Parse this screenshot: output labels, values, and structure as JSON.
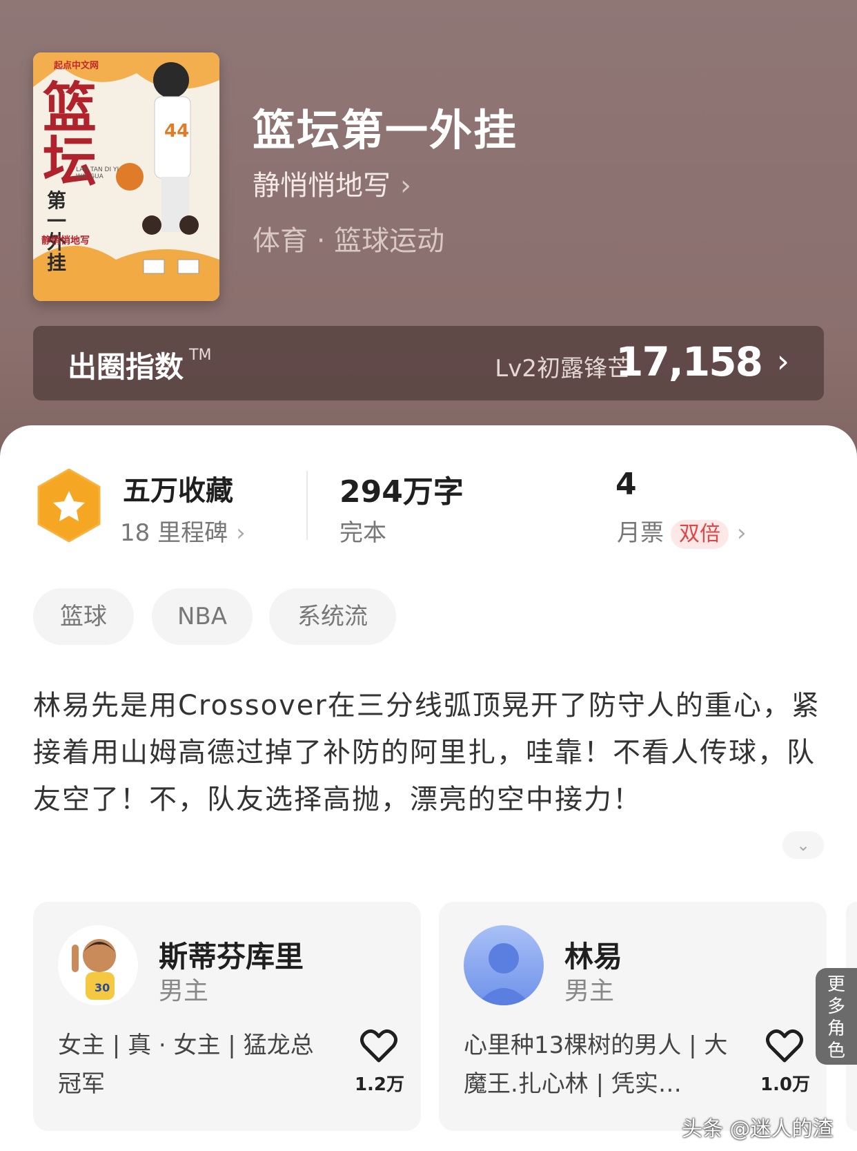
{
  "book": {
    "cover_publisher": "起点中文网",
    "cover_title_main": "篮坛",
    "cover_title_sub": "第一外挂",
    "cover_pinyin": "LAN TAN DI YI WAI GUA",
    "cover_author": "静悄悄地写",
    "title": "篮坛第一外挂",
    "author": "静悄悄地写",
    "genre": "体育 · 篮球运动"
  },
  "index": {
    "label": "出圈指数",
    "tm": "TM",
    "level": "Lv2初露锋芒",
    "value": "17,158"
  },
  "stats": {
    "collect_main": "五万收藏",
    "collect_sub": "18 里程碑",
    "words_main": "294万字",
    "words_sub": "完本",
    "ticket_main": "4",
    "ticket_sub": "月票",
    "ticket_badge": "双倍"
  },
  "tags": [
    "篮球",
    "NBA",
    "系统流"
  ],
  "description": "林易先是用Crossover在三分线弧顶晃开了防守人的重心，紧接着用山姆高德过掉了补防的阿里扎，哇靠！不看人传球，队友空了！不，队友选择高抛，漂亮的空中接力！",
  "roles": [
    {
      "name": "斯蒂芬库里",
      "type": "男主",
      "desc": "女主 | 真 · 女主 | 猛龙总冠军",
      "likes": "1.2万"
    },
    {
      "name": "林易",
      "type": "男主",
      "desc": "心里种13棵树的男人 | 大魔王.扎心林 | 凭实…",
      "likes": "1.0万"
    }
  ],
  "more_roles": [
    "更",
    "多",
    "角",
    "色"
  ],
  "watermark": "头条 @迷人的渣",
  "colors": {
    "accent_red": "#e04545",
    "star_orange": "#f5a623",
    "index_bg": "#5a4341"
  },
  "icons": [
    "star-badge-icon",
    "chevron-right-icon",
    "chevron-down-icon",
    "heart-icon"
  ]
}
